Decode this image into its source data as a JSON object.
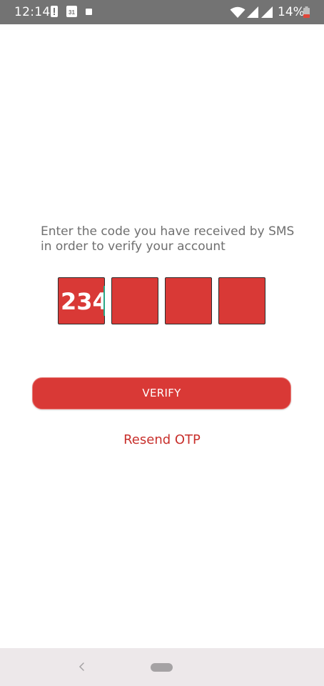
{
  "status_bar": {
    "time": "12:14",
    "calendar_day": "31",
    "battery_percent": "14%",
    "icons": [
      "alert-icon",
      "calendar-icon",
      "square-notification-icon",
      "wifi-icon",
      "signal-icon",
      "signal-icon",
      "battery-low-icon"
    ]
  },
  "verification": {
    "instruction_line1": "Enter the code you have received by SMS",
    "instruction_line2": "in order to verify your account",
    "otp_fields": [
      "234",
      "",
      "",
      ""
    ],
    "verify_label": "VERIFY",
    "resend_label": "Resend OTP"
  },
  "nav_bar": {
    "icons": [
      "back-icon",
      "home-pill-icon"
    ]
  },
  "colors": {
    "accent": "#d93936",
    "resend_text": "#c8302c",
    "status_bar": "#737373",
    "cursor": "#2aa787",
    "battery_low": "#e0473a"
  }
}
